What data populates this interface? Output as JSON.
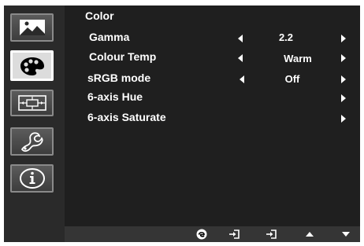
{
  "section_title": "Color",
  "sidebar": {
    "items": [
      {
        "icon": "picture-icon",
        "selected": false
      },
      {
        "icon": "palette-icon",
        "selected": true
      },
      {
        "icon": "display-position-icon",
        "selected": false
      },
      {
        "icon": "wrench-settings-icon",
        "selected": false
      },
      {
        "icon": "info-icon",
        "selected": false
      }
    ]
  },
  "menu": {
    "gamma": {
      "label": "Gamma",
      "value": "2.2"
    },
    "colour_temp": {
      "label": "Colour Temp",
      "value": "Warm"
    },
    "srgb_mode": {
      "label": "sRGB mode",
      "value": "Off"
    },
    "axis_hue": {
      "label": "6-axis Hue"
    },
    "axis_saturate": {
      "label": "6-axis Saturate"
    }
  },
  "bottom_bar": {
    "keys": [
      "e-key-icon",
      "input-select-icon",
      "enter-icon",
      "up-arrow-icon",
      "down-arrow-icon"
    ]
  },
  "colors": {
    "background": "#000000",
    "panel": "#1f1f1f",
    "sidebar": "#2a2a2a",
    "text": "#ffffff"
  }
}
